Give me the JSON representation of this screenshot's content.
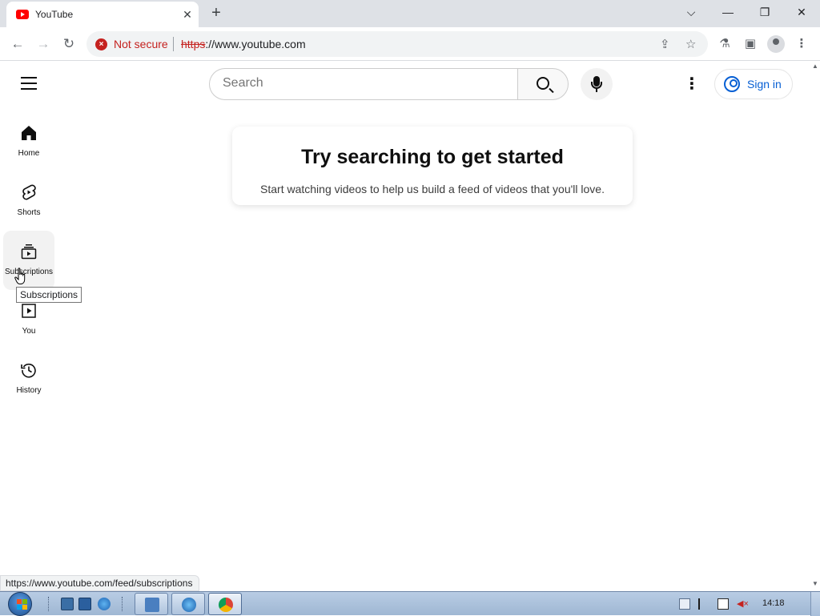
{
  "browser": {
    "tab_title": "YouTube",
    "new_tab_label": "+",
    "security_label": "Not secure",
    "url_scheme": "https",
    "url_rest": "://www.youtube.com",
    "status_url": "https://www.youtube.com/feed/subscriptions"
  },
  "header": {
    "search_placeholder": "Search",
    "signin_label": "Sign in"
  },
  "guide": {
    "items": [
      {
        "label": "Home",
        "icon": "home-icon"
      },
      {
        "label": "Shorts",
        "icon": "shorts-icon"
      },
      {
        "label": "Subscriptions",
        "icon": "subscriptions-icon"
      },
      {
        "label": "You",
        "icon": "you-icon"
      },
      {
        "label": "History",
        "icon": "history-icon"
      }
    ],
    "hovered": "Subscriptions"
  },
  "tooltip": {
    "text": "Subscriptions"
  },
  "main": {
    "prompt_title": "Try searching to get started",
    "prompt_subtitle": "Start watching videos to help us build a feed of videos that you'll love."
  },
  "taskbar": {
    "clock": "14:18"
  },
  "colors": {
    "youtube_red": "#ff0000",
    "link_blue": "#065fd4",
    "not_secure_red": "#c5221f"
  }
}
